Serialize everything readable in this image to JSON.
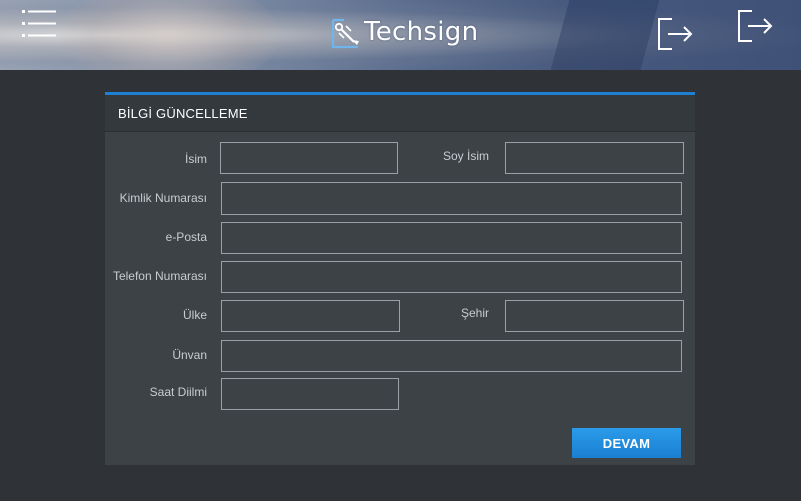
{
  "header": {
    "brand": "Techsign",
    "menu_icon": "hamburger-menu-icon",
    "exit_icon": "exit-icon"
  },
  "form": {
    "title": "BİLGİ GÜNCELLEME",
    "fields": {
      "first_name": {
        "label": "İsim",
        "value": ""
      },
      "last_name": {
        "label": "Soy İsim",
        "value": ""
      },
      "id_number": {
        "label": "Kimlik Numarası",
        "value": ""
      },
      "email": {
        "label": "e-Posta",
        "value": ""
      },
      "phone": {
        "label": "Telefon Numarası",
        "value": ""
      },
      "country": {
        "label": "Ülke",
        "value": ""
      },
      "city": {
        "label": "Şehir",
        "value": ""
      },
      "title": {
        "label": "Ünvan",
        "value": ""
      },
      "timezone": {
        "label": "Saat Diilmi",
        "value": ""
      }
    },
    "submit_label": "DEVAM"
  },
  "colors": {
    "accent": "#1f7fd1",
    "button": "#2b9bea",
    "background": "#2f3337",
    "panel": "#3d4247"
  }
}
